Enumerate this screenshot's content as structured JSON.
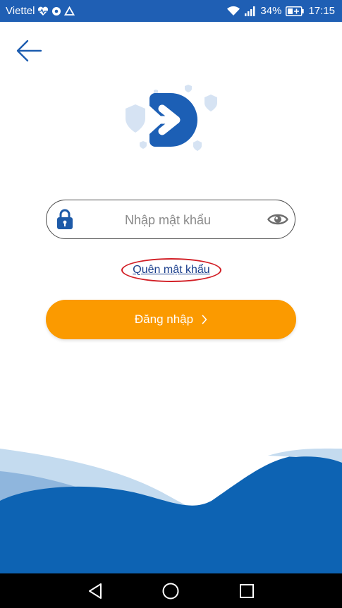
{
  "status_bar": {
    "carrier": "Viettel",
    "battery": "34%",
    "time": "17:15",
    "icons": [
      "heart-pulse-icon",
      "browser-icon",
      "drive-icon",
      "wifi-icon",
      "signal-icon",
      "battery-charging-icon"
    ]
  },
  "header": {
    "back_icon": "arrow-left-icon"
  },
  "login": {
    "password_placeholder": "Nhập mật khẩu",
    "password_value": "",
    "forgot_label": "Quên mật khẩu",
    "submit_label": "Đăng nhập",
    "submit_icon": "chevron-right-icon"
  },
  "nav": {
    "icons": [
      "back-triangle-icon",
      "home-circle-icon",
      "recents-square-icon"
    ]
  },
  "colors": {
    "status_bar": "#1f5fb4",
    "primary_blue": "#1565c0",
    "button_orange": "#fb9a00",
    "highlight_red": "#d21f26"
  }
}
